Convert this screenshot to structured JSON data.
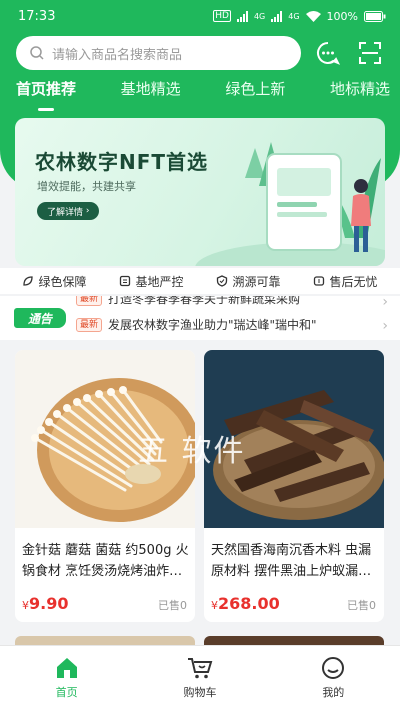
{
  "status": {
    "time": "17:33",
    "battery": "100%",
    "net1": "4G",
    "net2": "4G"
  },
  "search": {
    "placeholder": "请输入商品名搜索商品"
  },
  "tabs": [
    {
      "label": "首页推荐",
      "active": true
    },
    {
      "label": "基地精选",
      "active": false
    },
    {
      "label": "绿色上新",
      "active": false
    },
    {
      "label": "地标精选",
      "active": false
    }
  ],
  "banner": {
    "title": "农林数字NFT首选",
    "subtitle": "增效提能，共建共享",
    "button": "了解详情"
  },
  "features": [
    {
      "label": "绿色保障",
      "icon": "leaf-icon"
    },
    {
      "label": "基地严控",
      "icon": "doc-icon"
    },
    {
      "label": "溯源可靠",
      "icon": "shield-icon"
    },
    {
      "label": "售后无忧",
      "icon": "service-icon"
    }
  ],
  "notice": {
    "tag": "通告",
    "items": [
      {
        "badge": "最新",
        "text": "打造冬季春季春季关于新鲜蔬菜采购"
      },
      {
        "badge": "最新",
        "text": "发展农林数字渔业助力\"瑞达峰\"瑞中和\""
      }
    ]
  },
  "products": [
    {
      "name": "金针菇 蘑菇 菌菇 约500g 火锅食材 烹饪煲汤烧烤油炸…",
      "currency": "¥",
      "price": "9.90",
      "sold": "已售0"
    },
    {
      "name": "天然国香海南沉香木料 虫漏原材料 摆件黑油上炉蚁漏…",
      "currency": "¥",
      "price": "268.00",
      "sold": "已售0"
    }
  ],
  "watermark": "五 软件",
  "nav": [
    {
      "label": "首页",
      "icon": "home-icon",
      "active": true
    },
    {
      "label": "购物车",
      "icon": "cart-icon",
      "active": false
    },
    {
      "label": "我的",
      "icon": "profile-icon",
      "active": false
    }
  ],
  "colors": {
    "brand": "#1fb85c",
    "price": "#e8312d"
  }
}
